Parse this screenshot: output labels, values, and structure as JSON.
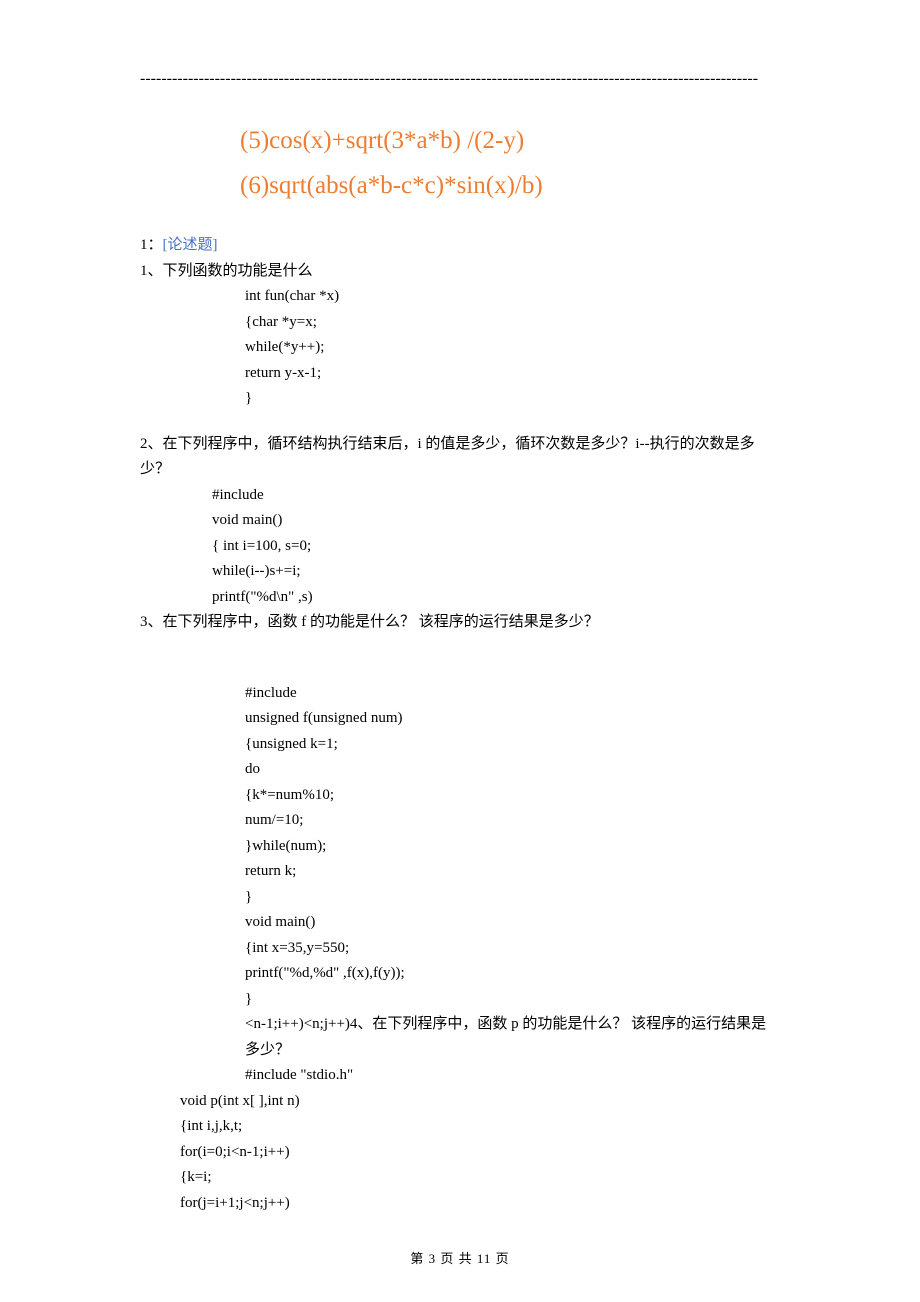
{
  "hr": "--------------------------------------------------------------------------------------------------------------------",
  "orange": {
    "l1": "(5)cos(x)+sqrt(3*a*b) /(2-y)",
    "l2": "(6)sqrt(abs(a*b-c*c)*sin(x)/b)"
  },
  "q1": {
    "prefix": "1：",
    "tag": "[论述题]",
    "body1": "1、下列函数的功能是什么",
    "code": [
      "  int fun(char *x)",
      "{char *y=x;",
      "  while(*y++);",
      "  return y-x-1;",
      "}"
    ]
  },
  "q2": {
    "body": "2、在下列程序中，循环结构执行结束后，i 的值是多少，循环次数是多少？i--执行的次数是多少？",
    "code": [
      "#include",
      "void     main()",
      " { int i=100, s=0;",
      "       while(i--)s+=i;",
      "printf(\"%d\\n\" ,s)"
    ]
  },
  "q3": {
    "body": "3、在下列程序中，函数 f 的功能是什么？  该程序的运行结果是多少？",
    "code": [
      "#include",
      "unsigned f(unsigned num)",
      "{unsigned k=1;",
      " do",
      "    {k*=num%10;",
      "     num/=10;",
      "}while(num);",
      "       return k;",
      "}",
      "void main()",
      "{int x=35,y=550;",
      " printf(\"%d,%d\" ,f(x),f(y));",
      "}"
    ],
    "tail": "<n-1;i++)<n;j++)4、在下列程序中，函数 p 的功能是什么？  该程序的运行结果是多少？",
    "tail2": "#include \"stdio.h\""
  },
  "q4code": [
    "void    p(int x[ ],int n)",
    "   {int i,j,k,t;",
    "    for(i=0;i<n-1;i++)",
    "       {k=i;",
    "         for(j=i+1;j<n;j++)"
  ],
  "footer": "第  3  页  共  11  页"
}
